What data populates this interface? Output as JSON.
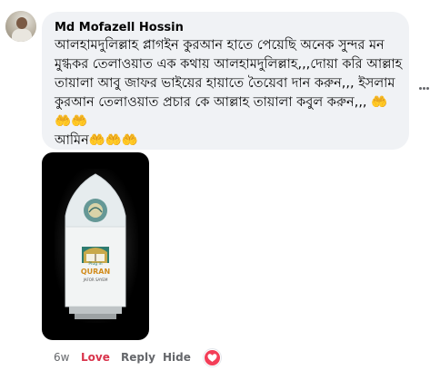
{
  "comment": {
    "author": "Md Mofazell Hossin",
    "text": "আলহামদুলিল্লাহ প্লাগইন কুরআন হাতে পেয়েছি অনেক সুন্দর মন মুগ্ধকর তেলাওয়াত এক কথায় আলহামদুলিল্লাহ,,,দোয়া করি আল্লাহ তায়ালা আবু জাফর ভাইয়ের হায়াতে তৈয়েবা দান করুন,,, ইসলাম কুরআন তেলাওয়াত প্রচার কে আল্লাহ তায়ালা কবুল করুন,,, ",
    "text_end": "আমিন",
    "emoji_after_text": "🤲🤲🤲",
    "emoji_after_amen": "🤲🤲🤲"
  },
  "photo": {
    "sign_text": "Al-Quran",
    "lamp_label": "QURAN",
    "lamp_sublabel": "Plug in",
    "lamp_footer": "JAFOR SAYEM"
  },
  "actions": {
    "time": "6w",
    "love": "Love",
    "reply": "Reply",
    "hide": "Hide"
  },
  "colors": {
    "bubble": "#f0f2f5",
    "love": "#d9344c",
    "secondary_text": "#65676b",
    "reaction": "#f33e58"
  },
  "icons": [
    "more-icon",
    "heart-reaction-icon",
    "avatar"
  ]
}
